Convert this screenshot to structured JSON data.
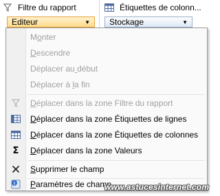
{
  "zones": {
    "left": {
      "title": "Filtre du rapport",
      "icon": "filter-icon",
      "field": "Editeur"
    },
    "right": {
      "title": "Étiquettes de colonn...",
      "icon": "column-labels-icon",
      "field": "Stockage"
    }
  },
  "menu": {
    "items": [
      {
        "label": "Monter",
        "underline_index": 1,
        "enabled": false,
        "icon": ""
      },
      {
        "label": "Descendre",
        "underline_index": 0,
        "enabled": false,
        "icon": ""
      },
      {
        "label": "Déplacer au début",
        "underline_index": 11,
        "enabled": false,
        "icon": ""
      },
      {
        "label": "Déplacer à la fin",
        "underline_index": 11,
        "enabled": false,
        "icon": ""
      },
      {
        "label": "Déplacer dans la zone Filtre du rapport",
        "underline_index": 0,
        "enabled": false,
        "icon": "filter-icon"
      },
      {
        "label": "Déplacer dans la zone Étiquettes de lignes",
        "underline_index": 0,
        "enabled": true,
        "icon": "row-labels-icon"
      },
      {
        "label": "Déplacer dans la zone Étiquettes de colonnes",
        "underline_index": 0,
        "enabled": true,
        "icon": "column-labels-icon"
      },
      {
        "label": "Déplacer dans la zone Valeurs",
        "underline_index": 0,
        "enabled": true,
        "icon": "sigma-icon"
      },
      {
        "label": "Supprimer le champ",
        "underline_index": 0,
        "enabled": true,
        "icon": "delete-icon"
      },
      {
        "label": "Paramètres de champ...",
        "underline_index": 0,
        "enabled": true,
        "icon": "field-settings-icon"
      }
    ]
  },
  "watermark": "www.astucesinternet.com"
}
